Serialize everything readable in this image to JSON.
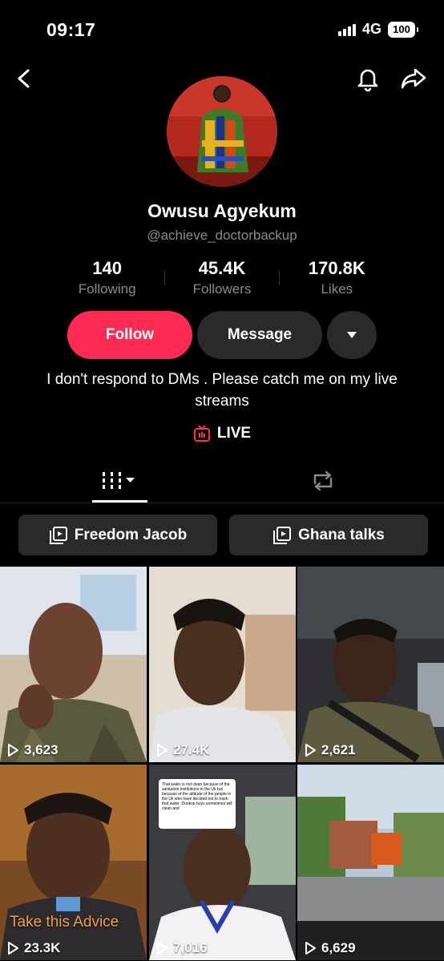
{
  "status_bar": {
    "time": "09:17",
    "network": "4G",
    "battery": "100"
  },
  "profile": {
    "name": "Owusu Agyekum",
    "handle": "@achieve_doctorbackup",
    "bio": "I don't respond to DMs . Please catch me on my live streams",
    "live_label": "LIVE"
  },
  "stats": [
    {
      "value": "140",
      "label": "Following"
    },
    {
      "value": "45.4K",
      "label": "Followers"
    },
    {
      "value": "170.8K",
      "label": "Likes"
    }
  ],
  "buttons": {
    "follow": "Follow",
    "message": "Message"
  },
  "playlists": [
    "Freedom Jacob",
    "Ghana talks"
  ],
  "videos": [
    {
      "views": "3,623",
      "caption": ""
    },
    {
      "views": "27.4K",
      "caption": ""
    },
    {
      "views": "2,621",
      "caption": ""
    },
    {
      "views": "23.3K",
      "caption": "Take this Advice"
    },
    {
      "views": "7,016",
      "caption": "",
      "comment_note": "That water is not clean because of the sanitation institutions in the Uk but because of the attitude of the people in the Uk who have decided not to trash that water. Dunkop boys sometimes will clean and"
    },
    {
      "views": "6,629",
      "caption": ""
    }
  ],
  "colors": {
    "accent": "#fe2c55",
    "button_dark": "#2a2a2a",
    "muted_text": "#8a8a8a"
  },
  "icons": [
    "back-icon",
    "bell-icon",
    "share-icon",
    "chevron-down-icon",
    "live-tv-icon",
    "grid-sort-icon",
    "repost-icon",
    "playlist-icon",
    "play-icon"
  ]
}
